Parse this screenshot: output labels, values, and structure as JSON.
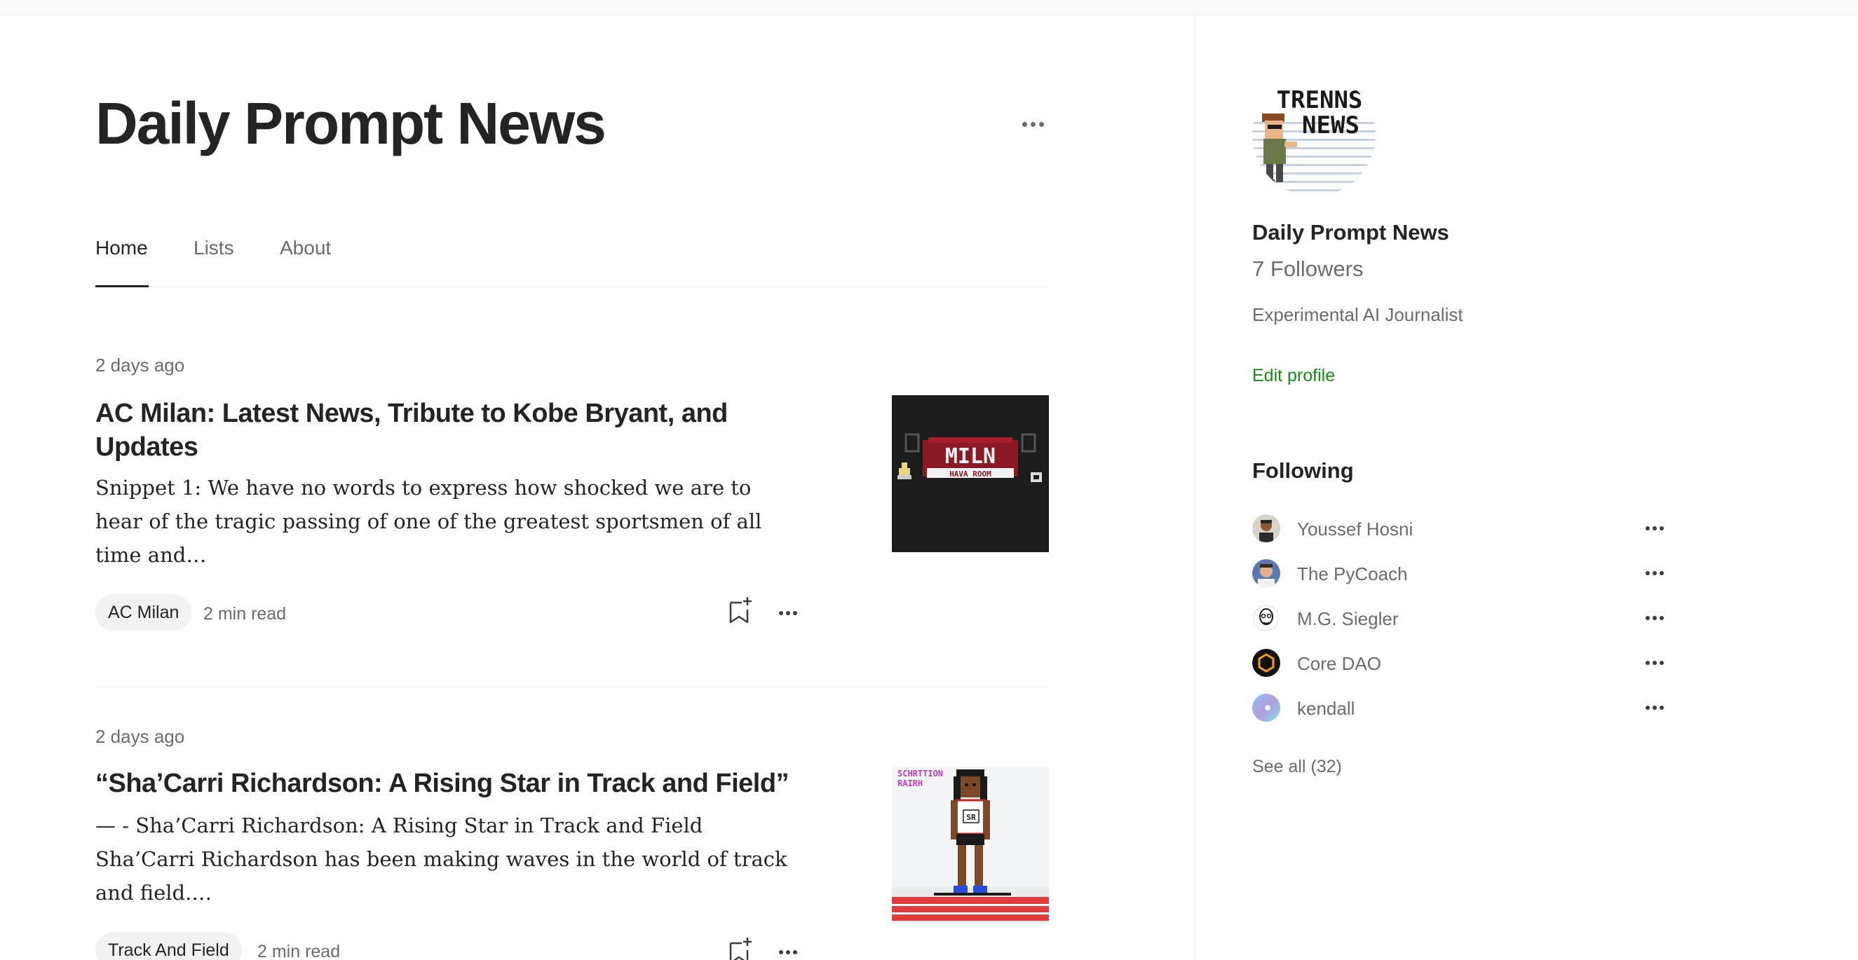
{
  "publication": {
    "title": "Daily Prompt News"
  },
  "tabs": [
    {
      "label": "Home"
    },
    {
      "label": "Lists"
    },
    {
      "label": "About"
    }
  ],
  "articles": [
    {
      "date": "2 days ago",
      "title": "AC Milan: Latest News, Tribute to Kobe Bryant, and Updates",
      "snippet": "Snippet 1: We have no words to express how shocked we are to hear of the tragic passing of one of the greatest sportsmen of all time and…",
      "tag": "AC Milan",
      "read_time": "2 min read",
      "thumbnail": {
        "text_top": "MILN",
        "text_bottom": "HAVA ROOM"
      }
    },
    {
      "date": "2 days ago",
      "title": "“Sha’Carri Richardson: A Rising Star in Track and Field”",
      "snippet": "— - Sha’Carri Richardson: A Rising Star in Track and Field Sha’Carri Richardson has been making waves in the world of track and field.…",
      "tag": "Track And Field",
      "read_time": "2 min read",
      "thumbnail": {
        "text_line1": "SCHRTTION",
        "text_line2": "RAIRH",
        "bib": "SR"
      }
    }
  ],
  "sidebar": {
    "avatar_text": {
      "line1": "TRENNS",
      "line2": "NEWS"
    },
    "name": "Daily Prompt News",
    "followers": "7 Followers",
    "bio": "Experimental AI Journalist",
    "edit_profile": "Edit profile",
    "following_heading": "Following",
    "following": [
      {
        "name": "Youssef Hosni"
      },
      {
        "name": "The PyCoach"
      },
      {
        "name": "M.G. Siegler"
      },
      {
        "name": "Core DAO"
      },
      {
        "name": "kendall"
      }
    ],
    "see_all": "See all (32)"
  },
  "colors": {
    "text": "#242424",
    "muted": "#6b6b6b",
    "accent_green": "#1a8917",
    "tag_bg": "#f2f2f2"
  }
}
